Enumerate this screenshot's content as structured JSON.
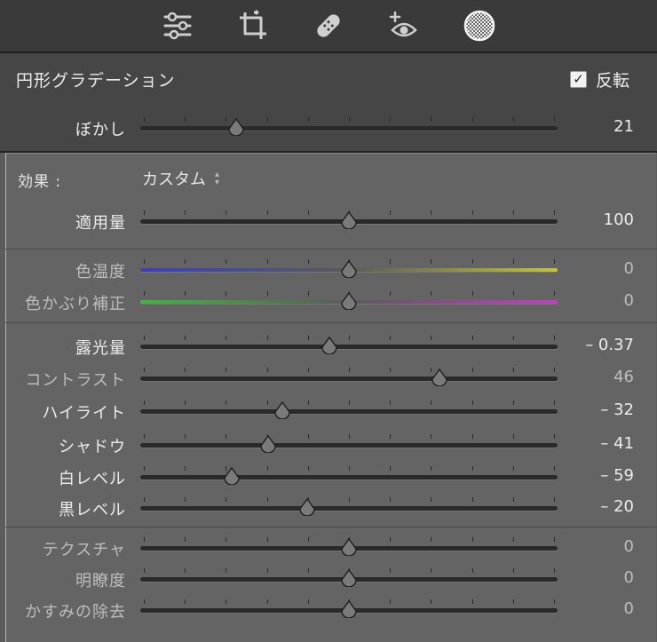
{
  "toolbar": {
    "tools": [
      {
        "name": "adjust-sliders-icon"
      },
      {
        "name": "crop-rotate-icon"
      },
      {
        "name": "healing-bandage-icon"
      },
      {
        "name": "redeye-icon"
      },
      {
        "name": "radial-gradient-icon",
        "active": true
      }
    ]
  },
  "header": {
    "title": "円形グラデーション",
    "invert_label": "反転",
    "invert_checked": "✓",
    "feather_label": "ぼかし",
    "feather_value": "21"
  },
  "effect": {
    "label": "効果 :",
    "preset": "カスタム"
  },
  "sliders": [
    {
      "id": "amount",
      "label": "適用量",
      "value": "100",
      "pos": 0.5,
      "dim": false
    },
    {
      "id": "temp",
      "label": "色温度",
      "value": "0",
      "pos": 0.5,
      "dim": true,
      "gradient": "temp"
    },
    {
      "id": "tint",
      "label": "色かぶり補正",
      "value": "0",
      "pos": 0.5,
      "dim": true,
      "gradient": "tint"
    },
    {
      "id": "exposure",
      "label": "露光量",
      "value": "– 0.37",
      "pos": 0.454,
      "dim": false
    },
    {
      "id": "contrast",
      "label": "コントラスト",
      "value": "46",
      "pos": 0.717,
      "dim": true
    },
    {
      "id": "highlights",
      "label": "ハイライト",
      "value": "– 32",
      "pos": 0.34,
      "dim": false
    },
    {
      "id": "shadows",
      "label": "シャドウ",
      "value": "– 41",
      "pos": 0.307,
      "dim": false
    },
    {
      "id": "whites",
      "label": "白レベル",
      "value": "– 59",
      "pos": 0.22,
      "dim": false
    },
    {
      "id": "blacks",
      "label": "黒レベル",
      "value": "– 20",
      "pos": 0.4,
      "dim": false
    },
    {
      "id": "texture",
      "label": "テクスチャ",
      "value": "0",
      "pos": 0.5,
      "dim": true
    },
    {
      "id": "clarity",
      "label": "明瞭度",
      "value": "0",
      "pos": 0.5,
      "dim": true
    },
    {
      "id": "dehaze",
      "label": "かすみの除去",
      "value": "0",
      "pos": 0.5,
      "dim": true
    }
  ],
  "feather_pos": 0.23,
  "colors": {
    "temp_left": "#3b3fc0",
    "temp_right": "#c4c43a",
    "tint_left": "#3fb83f",
    "tint_right": "#c23fc2",
    "thumb": "#7a7a7a"
  }
}
